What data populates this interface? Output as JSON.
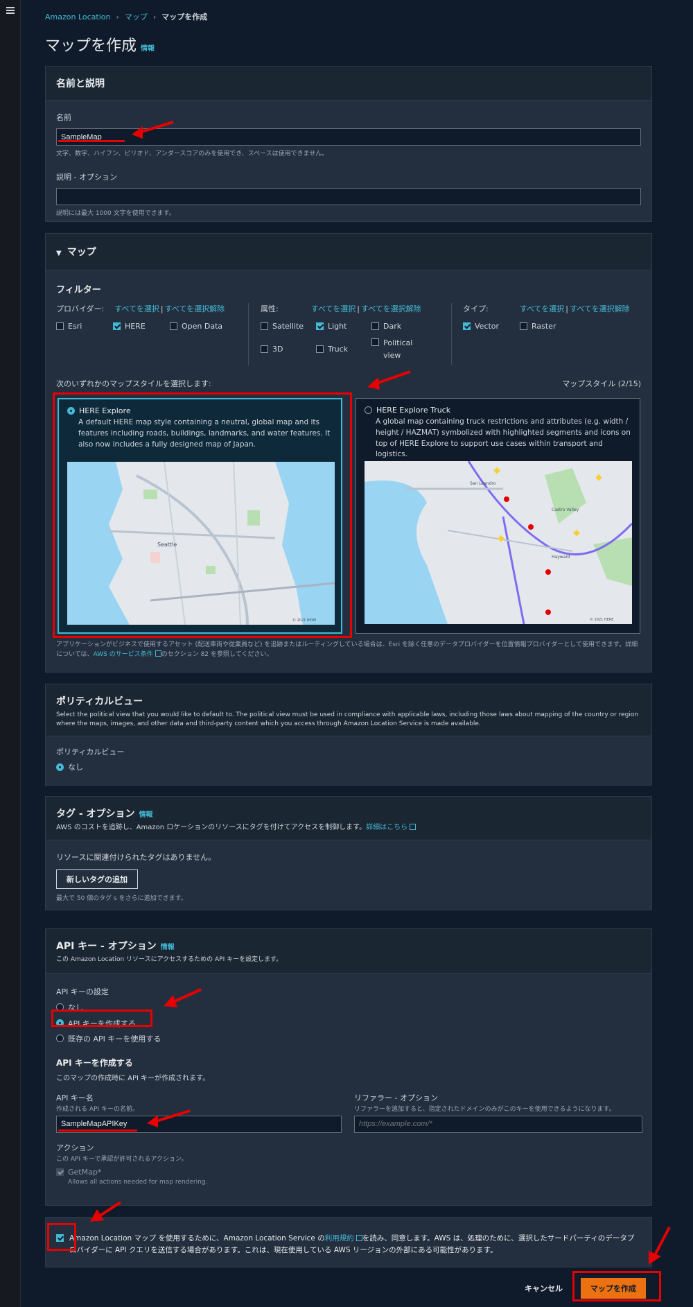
{
  "breadcrumb": {
    "root": "Amazon Location",
    "parent": "マップ",
    "current": "マップを作成"
  },
  "page": {
    "title": "マップを作成",
    "info": "情報"
  },
  "name_section": {
    "title": "名前と説明",
    "name_label": "名前",
    "name_value": "SampleMap",
    "name_hint": "文字、数字、ハイフン、ピリオド、アンダースコアのみを使用でき、スペースは使用できません。",
    "desc_label": "説明 - オプション",
    "desc_value": "",
    "desc_hint": "説明には最大 1000 文字を使用できます。"
  },
  "map_section": {
    "title": "マップ",
    "filter_title": "フィルター",
    "provider_label": "プロバイダー:",
    "attribute_label": "属性:",
    "type_label": "タイプ:",
    "select_all": "すべてを選択",
    "deselect_all": "すべてを選択解除",
    "sep": "|",
    "providers": [
      {
        "label": "Esri",
        "checked": false
      },
      {
        "label": "HERE",
        "checked": true
      },
      {
        "label": "Open Data",
        "checked": false
      }
    ],
    "attributes": [
      {
        "label": "Satellite",
        "checked": false
      },
      {
        "label": "Light",
        "checked": true
      },
      {
        "label": "Dark",
        "checked": false
      },
      {
        "label": "3D",
        "checked": false
      },
      {
        "label": "Truck",
        "checked": false
      },
      {
        "label": "Political view",
        "checked": false
      }
    ],
    "types": [
      {
        "label": "Vector",
        "checked": true
      },
      {
        "label": "Raster",
        "checked": false
      }
    ],
    "style_prompt": "次のいずれかのマップスタイルを選択します:",
    "style_count": "マップスタイル (2/15)",
    "cards": [
      {
        "title": "HERE Explore",
        "desc": "A default HERE map style containing a neutral, global map and its features including roads, buildings, landmarks, and water features. It also now includes a fully designed map of Japan.",
        "selected": true,
        "copyright": "© 2021 HERE",
        "city_label": "Seattle"
      },
      {
        "title": "HERE Explore Truck",
        "desc": "A global map containing truck restrictions and attributes (e.g. width / height / HAZMAT) symbolized with highlighted segments and icons on top of HERE Explore to support use cases within transport and logistics.",
        "selected": false,
        "copyright": "© 2021 HERE",
        "city_label_1": "San Leandro",
        "city_label_2": "Hayward",
        "city_label_3": "Castro Valley"
      }
    ],
    "footnote_1": "アプリケーションがビジネスで使用するアセット (配送車両や従業員など) を追跡またはルーティングしている場合は、Esri を除く任意のデータプロバイダーを位置情報プロバイダーとして使用できます。詳細については、",
    "footnote_link": "AWS のサービス条件",
    "footnote_2": "のセクション 82 を参照してください。"
  },
  "political": {
    "title": "ポリティカルビュー",
    "sub": "Select the political view that you would like to default to. The political view must be used in compliance with applicable laws, including those laws about mapping of the country or region where the maps, images, and other data and third-party content which you access through Amazon Location Service is made available.",
    "label": "ポリティカルビュー",
    "option": "なし"
  },
  "tags": {
    "title": "タグ - オプション",
    "info": "情報",
    "sub": "AWS のコストを追跡し、Amazon ロケーションのリソースにタグを付けてアクセスを制御します。",
    "sub_link": "詳細はこちら",
    "empty": "リソースに関連付けられたタグはありません。",
    "add_button": "新しいタグの追加",
    "limit": "最大で 50 個のタグ s をさらに追加できます。"
  },
  "apikey": {
    "title": "API キー - オプション",
    "info": "情報",
    "sub": "この Amazon Location リソースにアクセスするための API キーを設定します。",
    "settings_label": "API キーの設定",
    "options": [
      "なし",
      "API キーを作成する",
      "既存の API キーを使用する"
    ],
    "selected_index": 1,
    "create_title": "API キーを作成する",
    "create_sub": "このマップの作成時に API キーが作成されます。",
    "name_label": "API キー名",
    "name_hint": "作成される API キーの名前。",
    "name_value": "SampleMapAPIKey",
    "referrer_label": "リファラー - オプション",
    "referrer_hint": "リファラーを追加すると、指定されたドメインのみがこのキーを使用できるようになります。",
    "referrer_placeholder": "https://example.com/*",
    "actions_label": "アクション",
    "actions_hint": "この API キーで承認が許可されるアクション。",
    "action_name": "GetMap*",
    "action_desc": "Allows all actions needed for map rendering."
  },
  "agreement": {
    "text_1": "Amazon Location マップ を使用するために、Amazon Location Service の",
    "link": "利用規約",
    "text_2": "を読み、同意します。AWS は、処理のために、選択したサードパーティのデータプロバイダーに API クエリを送信する場合があります。これは、現在使用している AWS リージョンの外部にある可能性があります。",
    "checked": true
  },
  "footer": {
    "cancel": "キャンセル",
    "submit": "マップを作成"
  },
  "colors": {
    "accent": "#44b9d6",
    "primary": "#ec7211",
    "highlight": "#e60000"
  }
}
